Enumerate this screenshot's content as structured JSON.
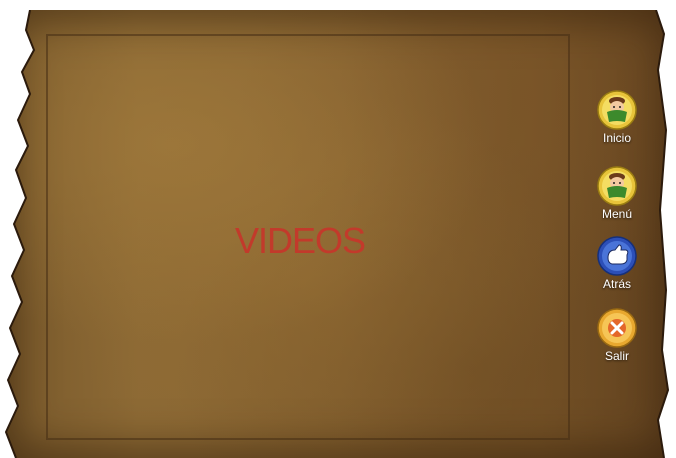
{
  "page": {
    "title": "VIDEOS"
  },
  "nav": {
    "items": [
      {
        "label": "Inicio",
        "icon": "book-character-icon"
      },
      {
        "label": "Menú",
        "icon": "book-character-icon"
      },
      {
        "label": "Atrás",
        "icon": "thumbs-up-icon"
      },
      {
        "label": "Salir",
        "icon": "exit-x-icon"
      }
    ]
  },
  "colors": {
    "title": "#c23a2b",
    "parchment": "#8a6633",
    "frame": "#46301a"
  }
}
